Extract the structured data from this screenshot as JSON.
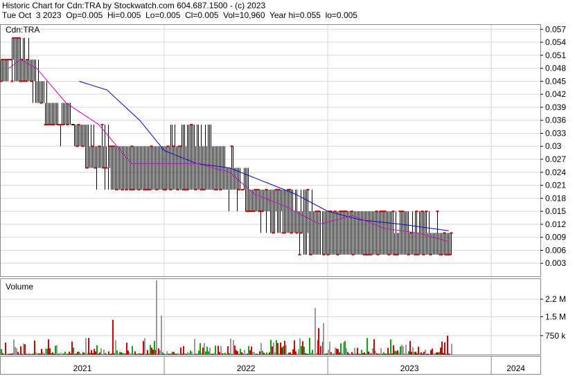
{
  "header": {
    "title": "Historic Chart for Cdn:TRA by Stockwatch.com 604.687.1500 - (c) 2023",
    "stats": "Tue Oct  3 2023  Op=0.005  Hi=0.005  Lo=0.005  Cl=0.005  Vol=10,960  Year hi=0.055  lo=0.005"
  },
  "chart_data": [
    {
      "type": "bar",
      "name": "price",
      "panel_label": "Cdn:TRA",
      "ylim": [
        0.0,
        0.058
      ],
      "yticks": [
        "0.057",
        "0.054",
        "0.051",
        "0.048",
        "0.045",
        "0.042",
        "0.039",
        "0.036",
        "0.033",
        "0.03",
        "0.027",
        "0.024",
        "0.021",
        "0.018",
        "0.015",
        "0.012",
        "0.009",
        "0.006",
        "0.003"
      ],
      "grid": true,
      "bars_note": "daily high-low bars; red dashes mark days closing lower",
      "price_keypoints": [
        {
          "t": 2021.02,
          "lo": 0.045,
          "hi": 0.05
        },
        {
          "t": 2021.1,
          "lo": 0.048,
          "hi": 0.055
        },
        {
          "t": 2021.2,
          "lo": 0.042,
          "hi": 0.05
        },
        {
          "t": 2021.3,
          "lo": 0.035,
          "hi": 0.04
        },
        {
          "t": 2021.45,
          "lo": 0.032,
          "hi": 0.036
        },
        {
          "t": 2021.55,
          "lo": 0.025,
          "hi": 0.033
        },
        {
          "t": 2021.75,
          "lo": 0.02,
          "hi": 0.03
        },
        {
          "t": 2022.0,
          "lo": 0.02,
          "hi": 0.03
        },
        {
          "t": 2022.15,
          "lo": 0.02,
          "hi": 0.035
        },
        {
          "t": 2022.35,
          "lo": 0.02,
          "hi": 0.03
        },
        {
          "t": 2022.55,
          "lo": 0.015,
          "hi": 0.02
        },
        {
          "t": 2022.75,
          "lo": 0.01,
          "hi": 0.02
        },
        {
          "t": 2022.95,
          "lo": 0.005,
          "hi": 0.015
        },
        {
          "t": 2023.1,
          "lo": 0.005,
          "hi": 0.015
        },
        {
          "t": 2023.3,
          "lo": 0.005,
          "hi": 0.015
        },
        {
          "t": 2023.6,
          "lo": 0.005,
          "hi": 0.012
        },
        {
          "t": 2023.75,
          "lo": 0.005,
          "hi": 0.01
        }
      ],
      "moving_averages": [
        {
          "color": "#0000cc",
          "points": [
            [
              2021.48,
              0.045
            ],
            [
              2021.65,
              0.043
            ],
            [
              2021.85,
              0.036
            ],
            [
              2022.0,
              0.029
            ],
            [
              2022.2,
              0.026
            ],
            [
              2022.4,
              0.025
            ],
            [
              2022.6,
              0.022
            ],
            [
              2022.8,
              0.019
            ],
            [
              2023.0,
              0.015
            ],
            [
              2023.2,
              0.013
            ],
            [
              2023.45,
              0.012
            ],
            [
              2023.74,
              0.0105
            ]
          ]
        },
        {
          "color": "#cc00cc",
          "points": [
            [
              2021.05,
              0.048
            ],
            [
              2021.12,
              0.05
            ],
            [
              2021.22,
              0.048
            ],
            [
              2021.4,
              0.04
            ],
            [
              2021.6,
              0.035
            ],
            [
              2021.8,
              0.026
            ],
            [
              2022.0,
              0.026
            ],
            [
              2022.2,
              0.026
            ],
            [
              2022.4,
              0.024
            ],
            [
              2022.55,
              0.019
            ],
            [
              2022.75,
              0.016
            ],
            [
              2022.95,
              0.012
            ],
            [
              2023.15,
              0.014
            ],
            [
              2023.35,
              0.011
            ],
            [
              2023.55,
              0.01
            ],
            [
              2023.74,
              0.008
            ]
          ]
        }
      ]
    },
    {
      "type": "bar",
      "name": "volume",
      "panel_label": "Volume",
      "ylim": [
        0,
        3000000
      ],
      "yticks": [
        "2.2 M",
        "1.5 M",
        "750 k"
      ],
      "ytick_values": [
        2200000,
        1500000,
        750000
      ],
      "volume_spikes": [
        {
          "t": 2021.68,
          "v": 1380000,
          "color": "red"
        },
        {
          "t": 2021.95,
          "v": 2950000,
          "color": "gray"
        },
        {
          "t": 2021.98,
          "v": 1550000,
          "color": "gray"
        },
        {
          "t": 2022.92,
          "v": 1850000,
          "color": "gray"
        },
        {
          "t": 2022.97,
          "v": 1250000,
          "color": "gray"
        },
        {
          "t": 2022.94,
          "v": 1050000,
          "color": "red"
        },
        {
          "t": 2023.73,
          "v": 750000,
          "color": "red"
        }
      ],
      "colors": {
        "up": "#00aa00",
        "down": "#cc0000",
        "unchanged": "#999999"
      }
    }
  ],
  "x_axis": {
    "labels": [
      "2021",
      "2022",
      "2023",
      "2024"
    ],
    "start": 2021.0,
    "end": 2024.3
  }
}
